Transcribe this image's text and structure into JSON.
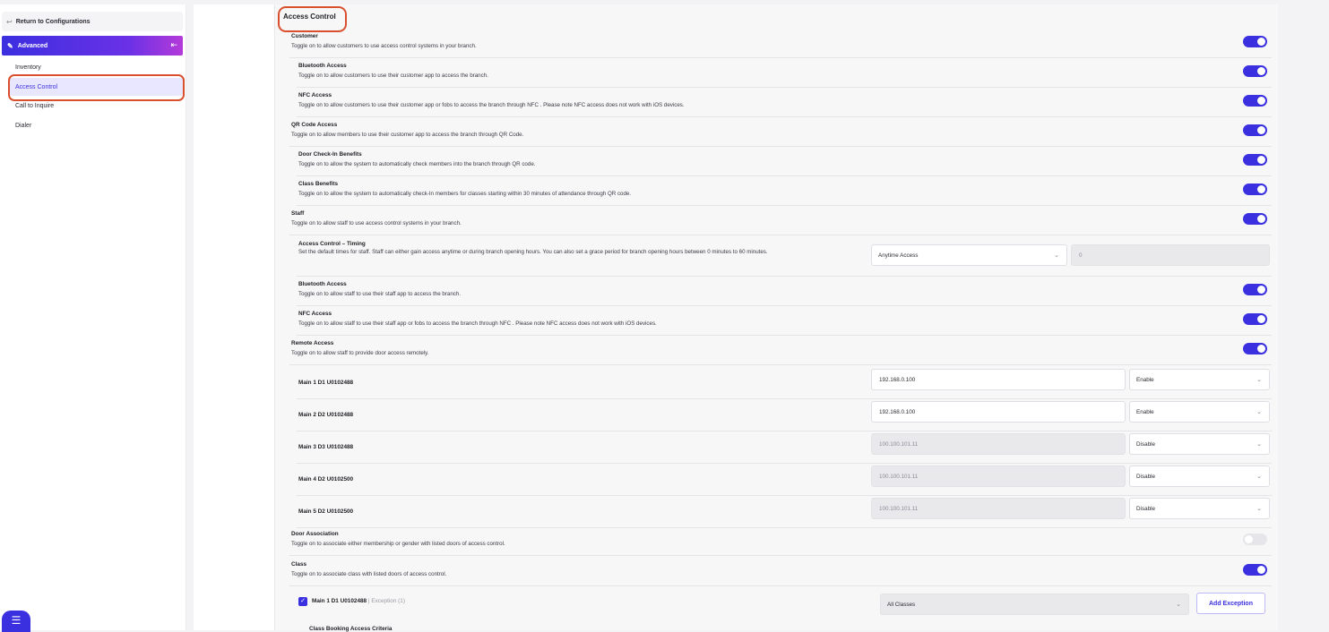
{
  "sidebar": {
    "return_label": "Return to Configurations",
    "section_label": "Advanced",
    "items": [
      {
        "label": "Inventory"
      },
      {
        "label": "Access Control"
      },
      {
        "label": "Call to Inquire"
      },
      {
        "label": "Dialer"
      }
    ]
  },
  "panel": {
    "title": "Access Control",
    "customer": {
      "title": "Customer",
      "desc": "Toggle on to allow customers to use access control systems in your branch."
    },
    "customer_bluetooth": {
      "title": "Bluetooth Access",
      "desc": "Toggle on to allow customers to use their customer app to access the branch."
    },
    "customer_nfc": {
      "title": "NFC Access",
      "desc": "Toggle on to allow customers to use their customer app or fobs to access the branch through NFC . Please note NFC access does not work with iOS devices."
    },
    "qr": {
      "title": "QR Code Access",
      "desc": "Toggle on to allow members to use their customer app to access the branch through QR Code."
    },
    "door_checkin": {
      "title": "Door Check-In Benefits",
      "desc": "Toggle on to allow the system to automatically check members into the branch through QR code."
    },
    "class_benefits": {
      "title": "Class Benefits",
      "desc": "Toggle on to allow the system to automatically check-In members for classes starting within 30 minutes of attendance through QR code."
    },
    "staff": {
      "title": "Staff",
      "desc": "Toggle on to allow staff to use access control systems in your branch."
    },
    "timing": {
      "title": "Access Control – Timing",
      "desc": "Set the default times for staff. Staff can either gain access anytime or during branch opening hours. You can also set a grace period for branch opening hours between 0 minutes to 60 minutes.",
      "select_value": "Anytime Access",
      "grace_value": "0"
    },
    "staff_bluetooth": {
      "title": "Bluetooth Access",
      "desc": "Toggle on to allow staff to use their staff app to access the branch."
    },
    "staff_nfc": {
      "title": "NFC Access",
      "desc": "Toggle on to allow staff to use their staff app or fobs to access the branch through NFC . Please note NFC access does not work with iOS devices."
    },
    "remote": {
      "title": "Remote Access",
      "desc": "Toggle on to allow staff to provide door access remotely."
    },
    "doors": [
      {
        "name": "Main 1 D1 U0102488",
        "ip": "192.168.0.100",
        "status": "Enable"
      },
      {
        "name": "Main 2 D2 U0102488",
        "ip": "192.168.0.100",
        "status": "Enable"
      },
      {
        "name": "Main 3 D3 U0102488",
        "ip": "100.100.101.11",
        "status": "Disable"
      },
      {
        "name": "Main 4 D2 U0102500",
        "ip": "100.100.101.11",
        "status": "Disable"
      },
      {
        "name": "Main 5 D2 U0102500",
        "ip": "100.100.101.11",
        "status": "Disable"
      }
    ],
    "door_association": {
      "title": "Door Association",
      "desc": "Toggle on to associate either membership or gender with listed doors of access control."
    },
    "class": {
      "title": "Class",
      "desc": "Toggle on to associate class with listed doors of access control."
    },
    "class_door": {
      "name": "Main 1 D1 U0102488",
      "exception": "| Exception (1)",
      "select_value": "All Classes",
      "button": "Add Exception"
    },
    "cutoff_label": "Class Booking Access Criteria"
  },
  "colors": {
    "accent": "#3b30e0",
    "highlight": "#d9502f"
  }
}
